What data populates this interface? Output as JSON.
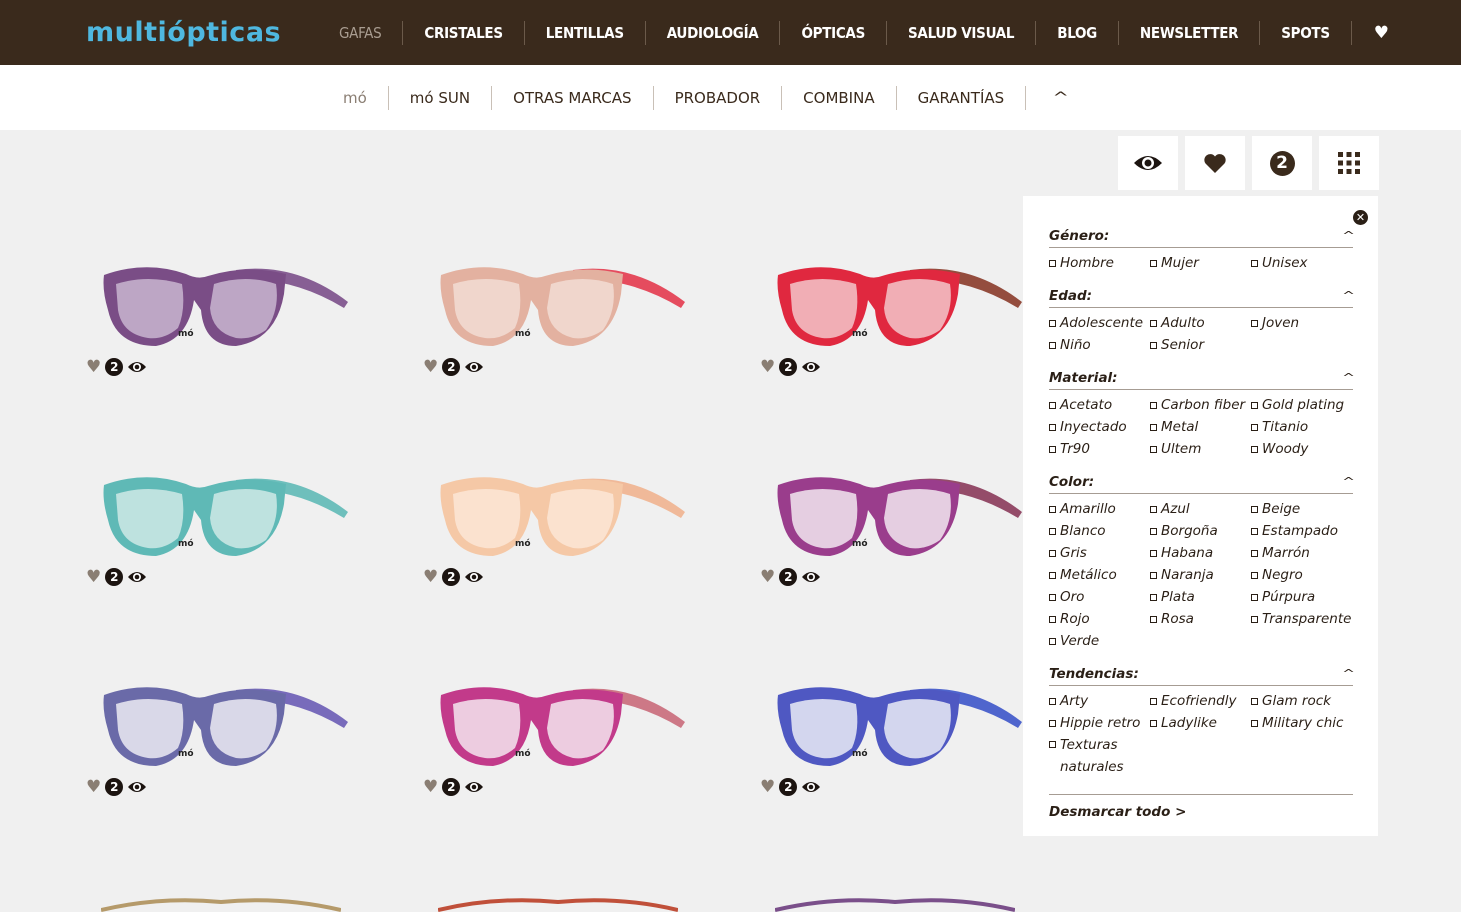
{
  "brand": {
    "logo_text": "multiópticas",
    "color": "#4fb8e0"
  },
  "colors": {
    "topbar": "#3a2a1c",
    "page_bg": "#f0f0f0"
  },
  "main_nav": {
    "items": [
      {
        "label": "GAFAS",
        "active": true
      },
      {
        "label": "CRISTALES"
      },
      {
        "label": "LENTILLAS"
      },
      {
        "label": "AUDIOLOGÍA"
      },
      {
        "label": "ÓPTICAS"
      },
      {
        "label": "SALUD VISUAL"
      },
      {
        "label": "BLOG"
      },
      {
        "label": "NEWSLETTER"
      },
      {
        "label": "SPOTS"
      }
    ],
    "favorites_icon": "heart-icon"
  },
  "sub_nav": {
    "items": [
      {
        "label": "mó",
        "active": true
      },
      {
        "label": "mó SUN"
      },
      {
        "label": "OTRAS MARCAS"
      },
      {
        "label": "PROBADOR"
      },
      {
        "label": "COMBINA"
      },
      {
        "label": "GARANTÍAS"
      }
    ],
    "collapse_icon": "chevron-up-icon"
  },
  "tools": {
    "compare_count": "2"
  },
  "products": [
    {
      "frame": "#7a4d86",
      "temple": "#7b4f8a",
      "lens": "#c9b6d0",
      "count": "2"
    },
    {
      "frame": "#e3b1a0",
      "temple": "#e33a4e",
      "lens": "#f2ddd4",
      "count": "2"
    },
    {
      "frame": "#e0283f",
      "temple": "#8a3b2a",
      "lens": "#f3c5ca",
      "count": "2"
    },
    {
      "frame": "#5fb9b6",
      "temple": "#5fb9b6",
      "lens": "#cfe9e6",
      "count": "2"
    },
    {
      "frame": "#f5c8a6",
      "temple": "#f0b38f",
      "lens": "#fbe6d6",
      "count": "2"
    },
    {
      "frame": "#9a3d8c",
      "temple": "#8a3a5a",
      "lens": "#f2e8f0",
      "count": "2"
    },
    {
      "frame": "#6a6aa8",
      "temple": "#6a5cb5",
      "lens": "#ecebf3",
      "count": "2"
    },
    {
      "frame": "#c23a8a",
      "temple": "#c96a7a",
      "lens": "#f4e6ee",
      "count": "2"
    },
    {
      "frame": "#4f58c2",
      "temple": "#3d55c9",
      "lens": "#eaecf6",
      "count": "2"
    }
  ],
  "filters": {
    "sections": [
      {
        "title": "Género:",
        "options": [
          "Hombre",
          "Mujer",
          "Unisex"
        ]
      },
      {
        "title": "Edad:",
        "options": [
          "Adolescente",
          "Adulto",
          "Joven",
          "Niño",
          "Senior"
        ]
      },
      {
        "title": "Material:",
        "options": [
          "Acetato",
          "Carbon fiber",
          "Gold plating",
          "Inyectado",
          "Metal",
          "Titanio",
          "Tr90",
          "Ultem",
          "Woody"
        ]
      },
      {
        "title": "Color:",
        "options": [
          "Amarillo",
          "Azul",
          "Beige",
          "Blanco",
          "Borgoña",
          "Estampado",
          "Gris",
          "Habana",
          "Marrón",
          "Metálico",
          "Naranja",
          "Negro",
          "Oro",
          "Plata",
          "Púrpura",
          "Rojo",
          "Rosa",
          "Transparente",
          "Verde"
        ]
      },
      {
        "title": "Tendencias:",
        "options": [
          "Arty",
          "Ecofriendly",
          "Glam rock",
          "Hippie retro",
          "Ladylike",
          "Military chic",
          "Texturas naturales"
        ]
      }
    ],
    "clear_all": "Desmarcar todo >"
  }
}
